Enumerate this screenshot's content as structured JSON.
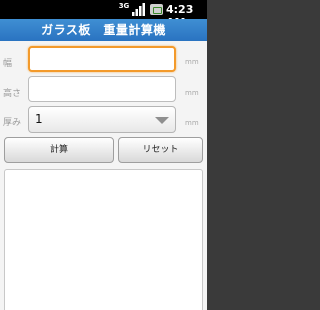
{
  "status": {
    "network": "3G",
    "time": "4:23 AM"
  },
  "title": "ガラス板　重量計算機",
  "form": {
    "width_label": "幅",
    "height_label": "高さ",
    "thickness_label": "厚み",
    "unit_mm": "mm",
    "thickness_value": "1"
  },
  "buttons": {
    "calculate": "計算",
    "reset": "リセット"
  }
}
